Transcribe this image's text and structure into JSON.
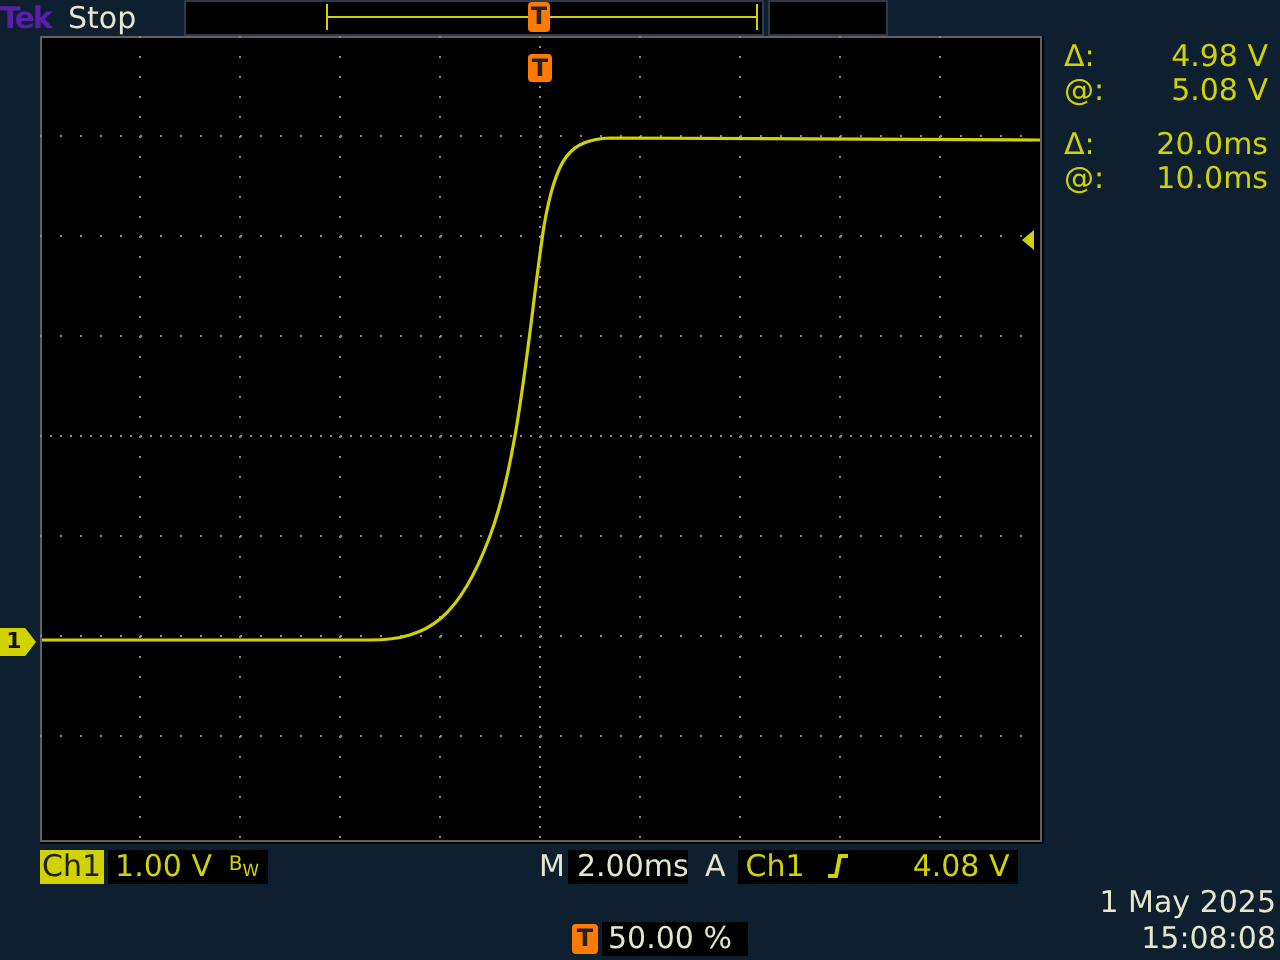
{
  "header": {
    "brand": "Tek",
    "status": "Stop",
    "trigger_marker": "T"
  },
  "graticule": {
    "trigger_marker": "T",
    "channel_marker": "1"
  },
  "measurements": [
    {
      "symbol": "Δ:",
      "value": "4.98 V"
    },
    {
      "symbol": "@:",
      "value": "5.08 V"
    },
    {
      "symbol": "Δ:",
      "value": "20.0ms"
    },
    {
      "symbol": "@:",
      "value": "10.0ms"
    }
  ],
  "readouts": {
    "channel": {
      "label": "Ch1",
      "scale": "1.00 V",
      "bandwidth": "B$_{W}$"
    },
    "timebase": {
      "label": "M",
      "value": "2.00ms"
    },
    "trigger": {
      "mode": "A",
      "source": "Ch1",
      "level": "4.08 V"
    },
    "position": {
      "marker": "T",
      "value": "50.00 %"
    },
    "date": "1 May 2025",
    "time": "15:08:08"
  }
}
